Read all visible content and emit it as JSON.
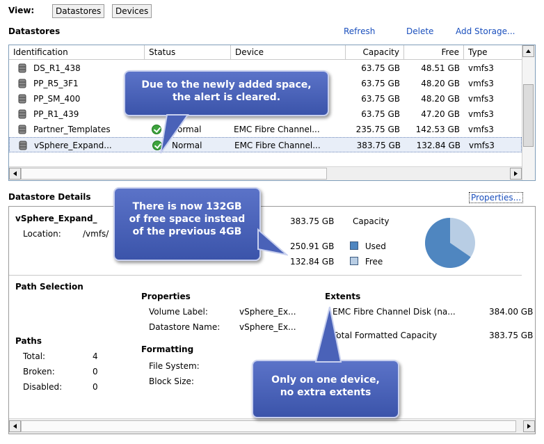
{
  "view": {
    "label": "View:",
    "tabs": [
      "Datastores",
      "Devices"
    ]
  },
  "datastores": {
    "heading": "Datastores",
    "actions": {
      "refresh": "Refresh",
      "delete": "Delete",
      "add_storage": "Add Storage..."
    },
    "columns": [
      "Identification",
      "Status",
      "Device",
      "Capacity",
      "Free",
      "Type"
    ],
    "rows": [
      {
        "name": "DS_R1_438",
        "status": "",
        "device": "",
        "capacity": "63.75 GB",
        "free": "48.51 GB",
        "type": "vmfs3"
      },
      {
        "name": "PP_R5_3F1",
        "status": "",
        "device": "",
        "capacity": "63.75 GB",
        "free": "48.20 GB",
        "type": "vmfs3"
      },
      {
        "name": "PP_SM_400",
        "status": "",
        "device": "",
        "capacity": "63.75 GB",
        "free": "48.20 GB",
        "type": "vmfs3"
      },
      {
        "name": "PP_R1_439",
        "status": "",
        "device": "",
        "capacity": "63.75 GB",
        "free": "47.20 GB",
        "type": "vmfs3"
      },
      {
        "name": "Partner_Templates",
        "status": "Normal",
        "device": "EMC Fibre Channel...",
        "capacity": "235.75 GB",
        "free": "142.53 GB",
        "type": "vmfs3"
      },
      {
        "name": "vSphere_Expand...",
        "status": "Normal",
        "device": "EMC Fibre Channel...",
        "capacity": "383.75 GB",
        "free": "132.84 GB",
        "type": "vmfs3"
      }
    ]
  },
  "details": {
    "heading": "Datastore Details",
    "properties_link": "Properties...",
    "name": "vSphere_Expand_",
    "location_label": "Location:",
    "location_value": "/vmfs/",
    "capacity_value": "383.75 GB",
    "capacity_label": "Capacity",
    "used_value": "250.91 GB",
    "used_label": "Used",
    "free_value": "132.84 GB",
    "free_label": "Free",
    "path_selection": "Path Selection",
    "paths_heading": "Paths",
    "paths": [
      {
        "label": "Total:",
        "value": "4"
      },
      {
        "label": "Broken:",
        "value": "0"
      },
      {
        "label": "Disabled:",
        "value": "0"
      }
    ],
    "properties_heading": "Properties",
    "volume_label_label": "Volume Label:",
    "volume_label_value": "vSphere_Ex...",
    "datastore_name_label": "Datastore Name:",
    "datastore_name_value": "vSphere_Ex...",
    "formatting_heading": "Formatting",
    "file_system_label": "File System:",
    "block_size_label": "Block Size:",
    "extents_heading": "Extents",
    "extent_name": "EMC Fibre Channel Disk (na...",
    "extent_size": "384.00 GB",
    "total_formatted_label": "Total Formatted Capacity",
    "total_formatted_value": "383.75 GB"
  },
  "callouts": {
    "alert_cleared_l1": "Due to the newly added space,",
    "alert_cleared_l2": "the alert is cleared.",
    "free_space_l1": "There is now 132GB",
    "free_space_l2": "of free space instead",
    "free_space_l3": "of the previous 4GB",
    "one_device_l1": "Only on one device,",
    "one_device_l2": "no extra extents"
  },
  "chart": {
    "used_fraction": 0.654,
    "used_color": "#4f86c0",
    "free_color": "#b8cde4"
  }
}
